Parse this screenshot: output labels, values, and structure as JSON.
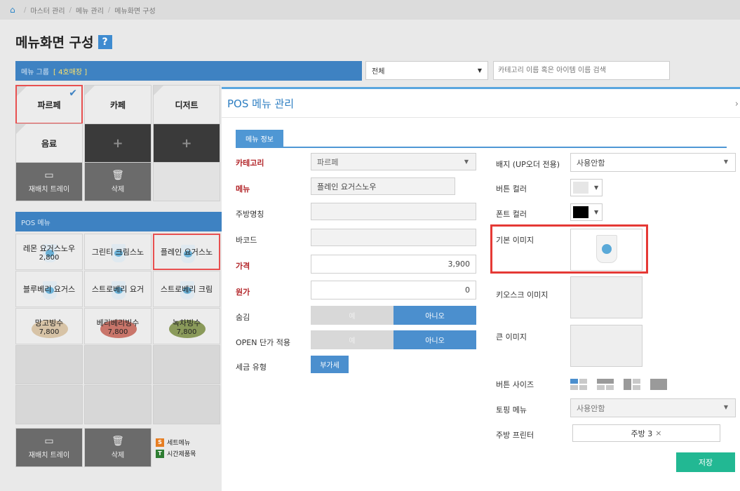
{
  "breadcrumb": {
    "items": [
      "마스터 관리",
      "메뉴 관리",
      "메뉴화면 구성"
    ],
    "separator": "/"
  },
  "page": {
    "title": "메뉴화면 구성",
    "help": "?"
  },
  "menu_group": {
    "header": "메뉴 그룹",
    "store": "[ 4호매장 ]",
    "cells": [
      "파르페",
      "카페",
      "디저트",
      "음료"
    ],
    "add": "+",
    "tray_label": "재배치 트레이",
    "delete_label": "삭제"
  },
  "filter": {
    "category": "전체",
    "search_placeholder": "카테고리 이름 혹은 아이템 이름 검색"
  },
  "pos_menu": {
    "header": "POS 메뉴",
    "items": [
      {
        "name": "레몬 요거스노우",
        "price": "2,800"
      },
      {
        "name": "그린티 크림스노",
        "price": ""
      },
      {
        "name": "플레인 요거스노",
        "price": ""
      },
      {
        "name": "블루베리 요거스",
        "price": ""
      },
      {
        "name": "스트로베리 요거",
        "price": ""
      },
      {
        "name": "스트로베리 크림",
        "price": ""
      },
      {
        "name": "망고빙수",
        "price": "7,800"
      },
      {
        "name": "베리베리빙수",
        "price": "7,800"
      },
      {
        "name": "녹차빙수",
        "price": "7,800"
      }
    ],
    "tray_label": "재배치 트레이",
    "delete_label": "삭제",
    "legend_set": "세트메뉴",
    "legend_time": "시간제품목",
    "legend_set_badge": "S",
    "legend_time_badge": "T"
  },
  "modal": {
    "title": "POS 메뉴 관리",
    "close": "›",
    "tab": "메뉴 정보",
    "left": {
      "category_label": "카테고리",
      "category_value": "파르페",
      "menu_label": "메뉴",
      "menu_value": "플레인 요거스노우",
      "kitchen_name_label": "주방명칭",
      "kitchen_name_value": "",
      "barcode_label": "바코드",
      "barcode_value": "",
      "price_label": "가격",
      "price_value": "3,900",
      "cost_label": "원가",
      "cost_value": "0",
      "hidden_label": "숨김",
      "yes": "예",
      "no": "아니오",
      "open_price_label": "OPEN 단가 적용",
      "tax_label": "세금 유형",
      "tax_value": "부가세"
    },
    "right": {
      "badge_label": "배지 (UP오더 전용)",
      "badge_value": "사용안함",
      "button_color_label": "버튼 컬러",
      "font_color_label": "폰트 컬러",
      "button_color": "#e6e6e6",
      "font_color": "#000000",
      "default_image_label": "기본 이미지",
      "kiosk_image_label": "키오스크 이미지",
      "large_image_label": "큰 이미지",
      "button_size_label": "버튼 사이즈",
      "topping_label": "토핑 메뉴",
      "topping_value": "사용안함",
      "printer_label": "주방 프린터",
      "printer_value": "주방 3",
      "printer_remove": "×",
      "save": "저장"
    }
  },
  "colors": {
    "accent": "#3e82c2",
    "save": "#22b893",
    "highlight": "#e53935",
    "required": "#b3262a",
    "set_badge": "#e67e22",
    "time_badge": "#2e7d32"
  }
}
